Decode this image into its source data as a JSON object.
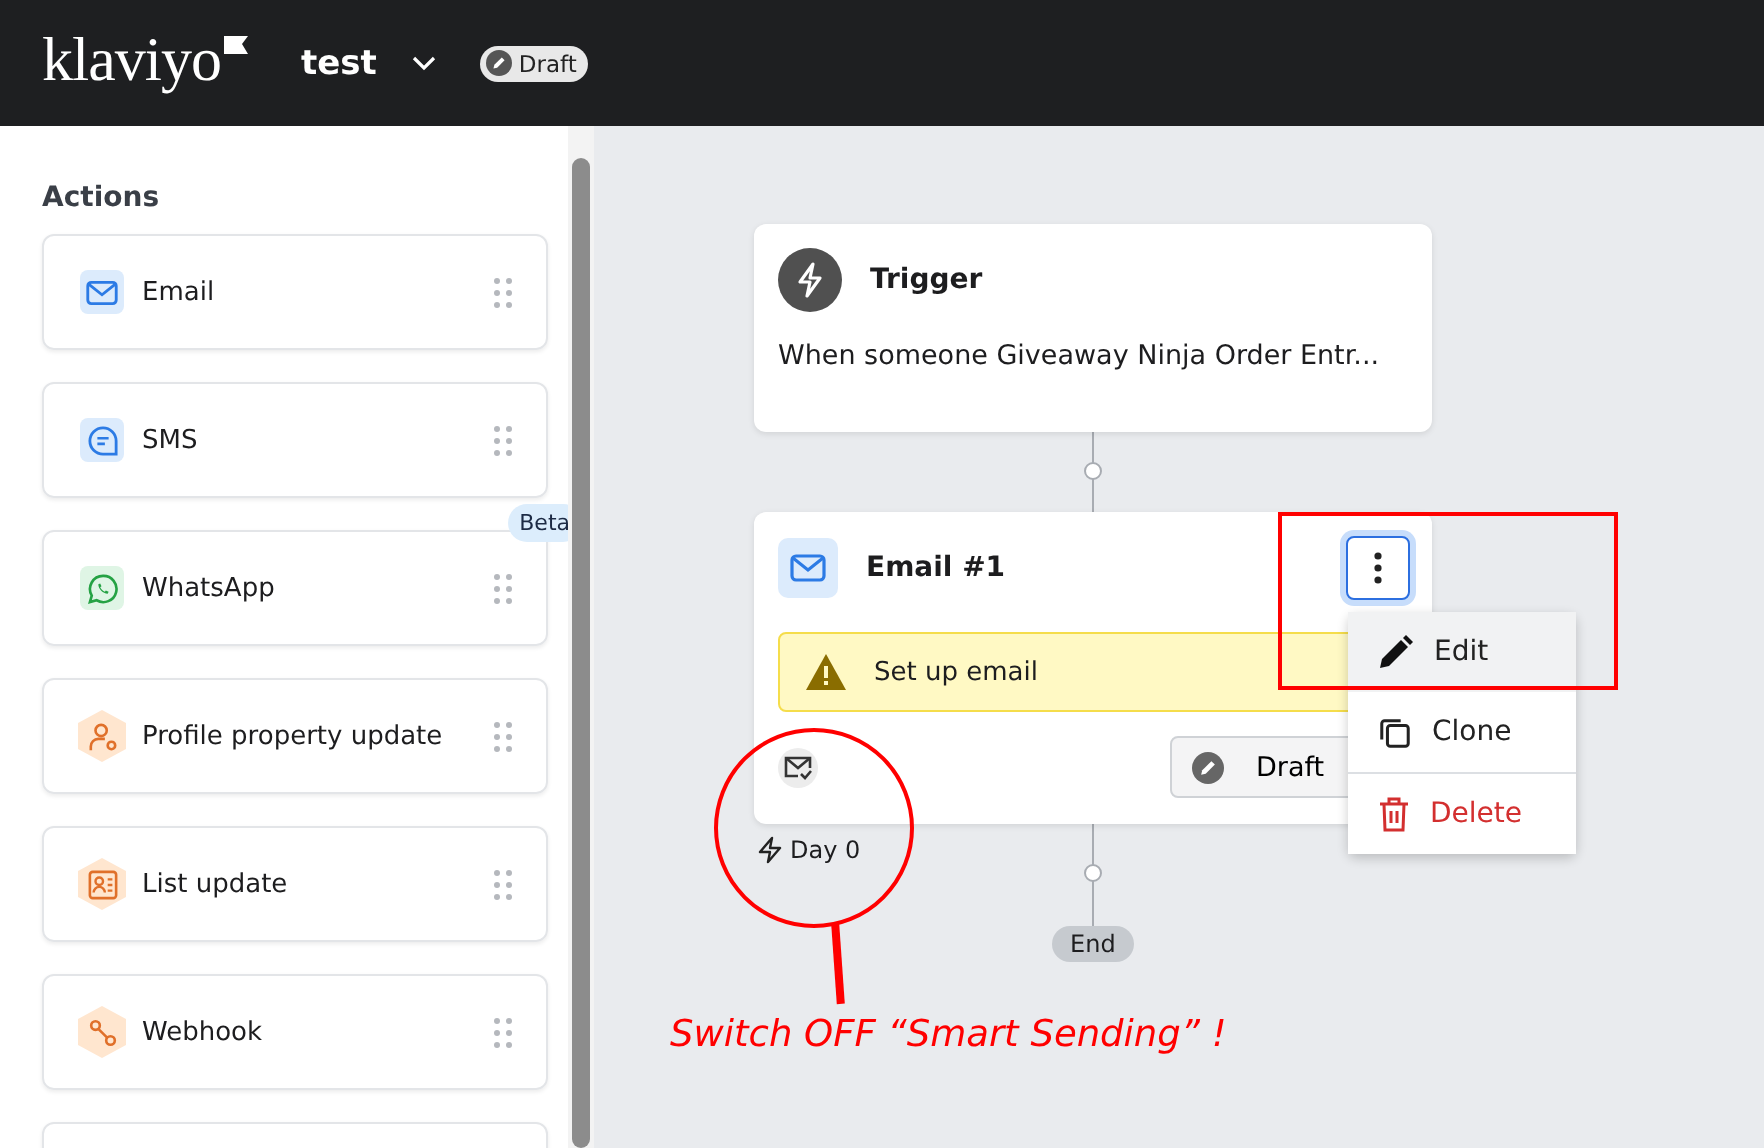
{
  "header": {
    "logo": "klaviyo",
    "flow_name": "test",
    "status": "Draft"
  },
  "sidebar": {
    "heading": "Actions",
    "items": [
      {
        "label": "Email",
        "kind": "email"
      },
      {
        "label": "SMS",
        "kind": "sms"
      },
      {
        "label": "WhatsApp",
        "kind": "whatsapp",
        "badge": "Beta"
      },
      {
        "label": "Profile property update",
        "kind": "profile"
      },
      {
        "label": "List update",
        "kind": "list"
      },
      {
        "label": "Webhook",
        "kind": "webhook"
      }
    ]
  },
  "trigger": {
    "title": "Trigger",
    "description": "When someone Giveaway Ninja Order Entr..."
  },
  "email_node": {
    "title": "Email #1",
    "warning": "Set up email",
    "status": "Draft",
    "delay": "Day 0"
  },
  "menu": [
    {
      "label": "Edit",
      "kind": "edit",
      "selected": true
    },
    {
      "label": "Clone",
      "kind": "clone",
      "selected": false
    },
    {
      "label": "Delete",
      "kind": "delete",
      "selected": false
    }
  ],
  "end_label": "End",
  "annotation": {
    "text": "Switch OFF “Smart Sending” !"
  }
}
